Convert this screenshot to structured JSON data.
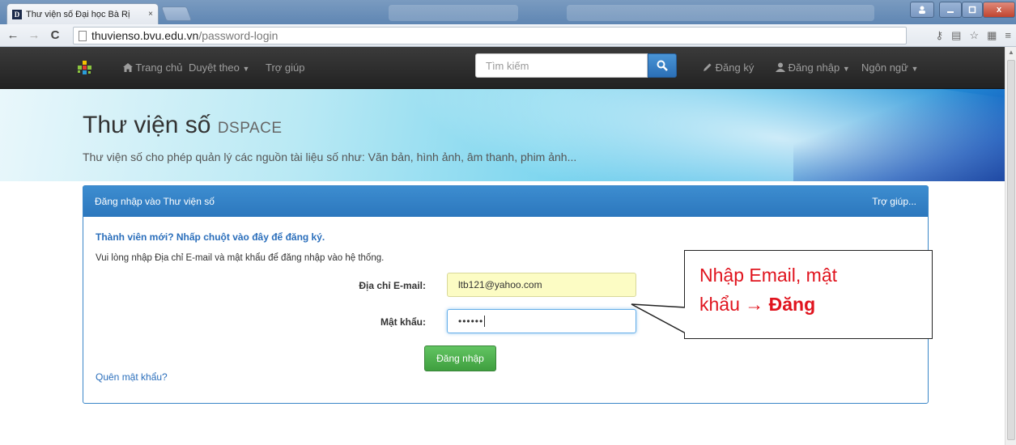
{
  "browser": {
    "tab_title": "Thư viện số Đại học Bà Rị",
    "tab_close": "×",
    "favicon_letter": "D",
    "url_host": "thuvienso.bvu.edu.vn",
    "url_path": "/password-login",
    "win_close": "x"
  },
  "navbar": {
    "home": "Trang chủ",
    "browse": "Duyệt theo",
    "help": "Trợ giúp",
    "search_placeholder": "Tìm kiếm",
    "register": "Đăng ký",
    "login": "Đăng nhập",
    "language": "Ngôn ngữ"
  },
  "jumbotron": {
    "title": "Thư viện số",
    "title_suffix": "DSPACE",
    "subtitle": "Thư viện số cho phép quản lý các nguồn tài liệu số như: Văn bản, hình ảnh, âm thanh, phim ảnh..."
  },
  "login_panel": {
    "heading": "Đăng nhập vào Thư viện số",
    "help_link": "Trợ giúp...",
    "new_member": "Thành viên mới? Nhấp chuột vào đây để đăng ký.",
    "instructions": "Vui lòng nhập Địa chỉ E-mail và mật khẩu để đăng nhập vào hệ thống.",
    "email_label": "Địa chỉ E-mail:",
    "email_value": "ltb121@yahoo.com",
    "password_label": "Mật khẩu:",
    "password_value": "••••••",
    "submit": "Đăng nhập",
    "forgot": "Quên mật khẩu?"
  },
  "callout": {
    "line1": "Nhập  Email, mật",
    "line2_prefix": "khẩu ",
    "arrow": "→",
    "line2_bold": "Đăng"
  },
  "colors": {
    "navbar_bg": "#222222",
    "panel_primary": "#337ab7",
    "success": "#5cb85c",
    "callout_text": "#e0141e"
  }
}
